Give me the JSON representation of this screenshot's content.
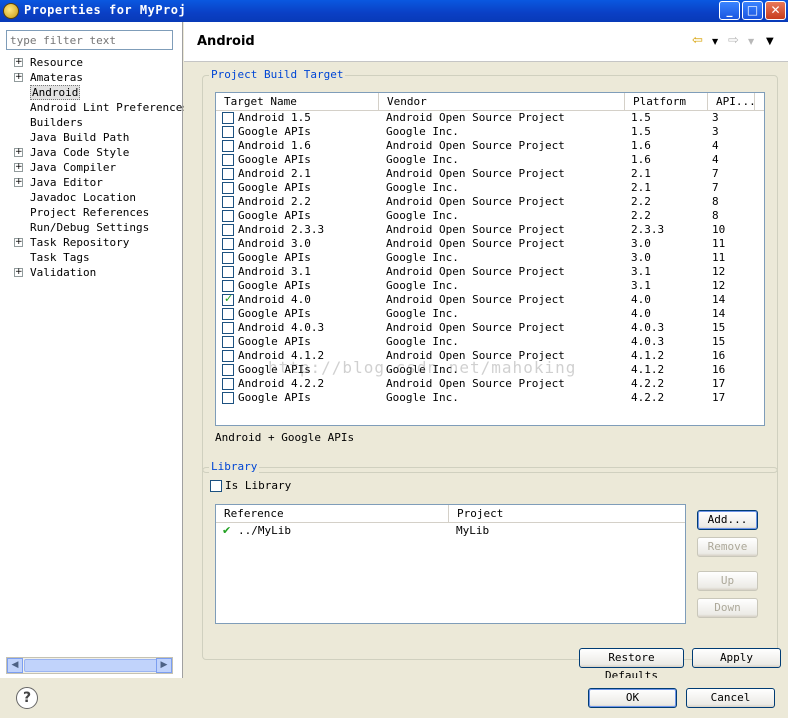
{
  "window": {
    "title": "Properties for MyProj"
  },
  "filter": {
    "placeholder": "type filter text"
  },
  "tree": [
    {
      "label": "Resource",
      "expandable": true
    },
    {
      "label": "Amateras",
      "expandable": true
    },
    {
      "label": "Android",
      "expandable": false,
      "selected": true
    },
    {
      "label": "Android Lint Preferences",
      "expandable": false
    },
    {
      "label": "Builders",
      "expandable": false
    },
    {
      "label": "Java Build Path",
      "expandable": false
    },
    {
      "label": "Java Code Style",
      "expandable": true
    },
    {
      "label": "Java Compiler",
      "expandable": true
    },
    {
      "label": "Java Editor",
      "expandable": true
    },
    {
      "label": "Javadoc Location",
      "expandable": false
    },
    {
      "label": "Project References",
      "expandable": false
    },
    {
      "label": "Run/Debug Settings",
      "expandable": false
    },
    {
      "label": "Task Repository",
      "expandable": true
    },
    {
      "label": "Task Tags",
      "expandable": false
    },
    {
      "label": "Validation",
      "expandable": true
    }
  ],
  "page": {
    "title": "Android"
  },
  "build_target": {
    "group_title": "Project Build Target",
    "columns": [
      "Target Name",
      "Vendor",
      "Platform",
      "API..."
    ],
    "rows": [
      {
        "name": "Android 1.5",
        "vendor": "Android Open Source Project",
        "platform": "1.5",
        "api": "3",
        "checked": false
      },
      {
        "name": "Google APIs",
        "vendor": "Google Inc.",
        "platform": "1.5",
        "api": "3",
        "checked": false
      },
      {
        "name": "Android 1.6",
        "vendor": "Android Open Source Project",
        "platform": "1.6",
        "api": "4",
        "checked": false
      },
      {
        "name": "Google APIs",
        "vendor": "Google Inc.",
        "platform": "1.6",
        "api": "4",
        "checked": false
      },
      {
        "name": "Android 2.1",
        "vendor": "Android Open Source Project",
        "platform": "2.1",
        "api": "7",
        "checked": false
      },
      {
        "name": "Google APIs",
        "vendor": "Google Inc.",
        "platform": "2.1",
        "api": "7",
        "checked": false
      },
      {
        "name": "Android 2.2",
        "vendor": "Android Open Source Project",
        "platform": "2.2",
        "api": "8",
        "checked": false
      },
      {
        "name": "Google APIs",
        "vendor": "Google Inc.",
        "platform": "2.2",
        "api": "8",
        "checked": false
      },
      {
        "name": "Android 2.3.3",
        "vendor": "Android Open Source Project",
        "platform": "2.3.3",
        "api": "10",
        "checked": false
      },
      {
        "name": "Android 3.0",
        "vendor": "Android Open Source Project",
        "platform": "3.0",
        "api": "11",
        "checked": false
      },
      {
        "name": "Google APIs",
        "vendor": "Google Inc.",
        "platform": "3.0",
        "api": "11",
        "checked": false
      },
      {
        "name": "Android 3.1",
        "vendor": "Android Open Source Project",
        "platform": "3.1",
        "api": "12",
        "checked": false
      },
      {
        "name": "Google APIs",
        "vendor": "Google Inc.",
        "platform": "3.1",
        "api": "12",
        "checked": false
      },
      {
        "name": "Android 4.0",
        "vendor": "Android Open Source Project",
        "platform": "4.0",
        "api": "14",
        "checked": true
      },
      {
        "name": "Google APIs",
        "vendor": "Google Inc.",
        "platform": "4.0",
        "api": "14",
        "checked": false
      },
      {
        "name": "Android 4.0.3",
        "vendor": "Android Open Source Project",
        "platform": "4.0.3",
        "api": "15",
        "checked": false
      },
      {
        "name": "Google APIs",
        "vendor": "Google Inc.",
        "platform": "4.0.3",
        "api": "15",
        "checked": false
      },
      {
        "name": "Android 4.1.2",
        "vendor": "Android Open Source Project",
        "platform": "4.1.2",
        "api": "16",
        "checked": false
      },
      {
        "name": "Google APIs",
        "vendor": "Google Inc.",
        "platform": "4.1.2",
        "api": "16",
        "checked": false
      },
      {
        "name": "Android 4.2.2",
        "vendor": "Android Open Source Project",
        "platform": "4.2.2",
        "api": "17",
        "checked": false
      },
      {
        "name": "Google APIs",
        "vendor": "Google Inc.",
        "platform": "4.2.2",
        "api": "17",
        "checked": false
      }
    ],
    "description": "Android + Google APIs"
  },
  "library": {
    "group_title": "Library",
    "is_library_label": "Is Library",
    "is_library_checked": false,
    "columns": [
      "Reference",
      "Project"
    ],
    "rows": [
      {
        "reference": "../MyLib",
        "project": "MyLib"
      }
    ],
    "buttons": {
      "add": "Add...",
      "remove": "Remove",
      "up": "Up",
      "down": "Down"
    }
  },
  "watermark": "http://blog.csdn.net/mahoking",
  "footer": {
    "restore_defaults": "Restore Defaults",
    "apply": "Apply",
    "ok": "OK",
    "cancel": "Cancel"
  }
}
